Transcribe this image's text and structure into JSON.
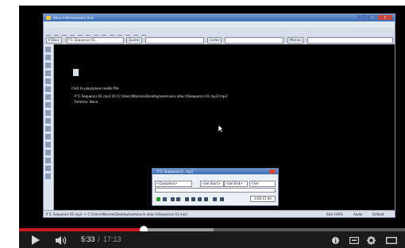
{
  "app": {
    "title": "Atlas.ti Hermeneutic Unit",
    "menu": [
      "File",
      "Edit",
      "Documents",
      "Quotations",
      "Codes",
      "Memos",
      "Networks",
      "Views",
      "Tools",
      "Extras",
      "A-Docs",
      "Windows",
      "Help"
    ],
    "toolbar2": {
      "primary_doc_label": "P-Docs",
      "primary_doc_value": "P 5: Sequence 01...",
      "quotes_label": "Quotes",
      "codes_label": "Codes",
      "memos_label": "Memos"
    },
    "document": {
      "hint": "Click to play/pause media file:",
      "file_line": "P 5: Sequence 01.mp3 (0) [C:\\Users\\Marcelo\\Desktop\\seminario atlas ti\\Sequence 01.mp3] mp3",
      "families_line": "Families: None"
    },
    "status": {
      "path": "P 5: Sequence 01.mp3 -> C:\\Users\\Marcelo\\Desktop\\seminario atlas ti\\Sequence 01.mp3",
      "size": "Size 100%",
      "audio": "Audio",
      "default": "Default"
    },
    "media_window": {
      "title": "P 5: Sequence 0...mp3",
      "quotation": "<Quotation>",
      "sel_start": "<Sel Start>",
      "sel_end": "<Sel End>",
      "sel": "<Sel",
      "time": "0:00:15.90"
    }
  },
  "player": {
    "current_time": "5:33",
    "separator": "/",
    "total_time": "17:13",
    "progress": 0.323,
    "buffered": 0.505,
    "icons": [
      "play-icon",
      "volume-icon",
      "info-icon",
      "captions-icon",
      "settings-icon",
      "fullscreen-icon"
    ],
    "colors": {
      "played": "#cc181e",
      "background": "#000000",
      "bar": "#1b1b1b"
    }
  }
}
